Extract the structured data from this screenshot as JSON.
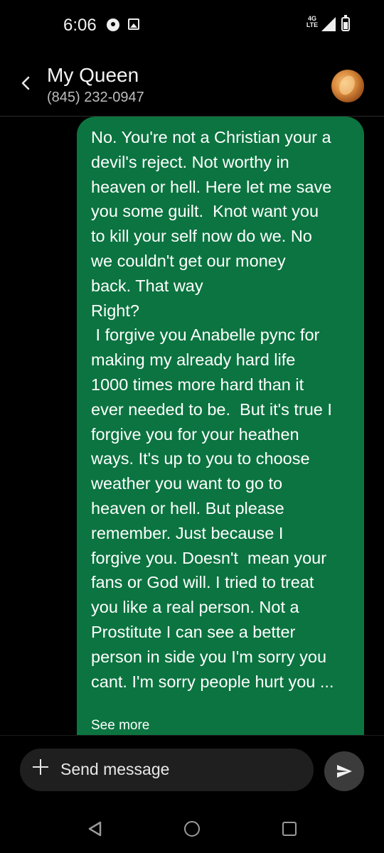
{
  "status_bar": {
    "time": "6:06",
    "network_type": "4G LTE",
    "icons": [
      "message-notification-icon",
      "gallery-icon",
      "signal-icon",
      "battery-icon"
    ]
  },
  "header": {
    "contact_name": "My Queen",
    "contact_number": "(845) 232-0947",
    "back_icon": "chevron-left-icon",
    "avatar": "contact-avatar"
  },
  "message": {
    "lines": [
      "No. You're not a Christian your a",
      "devil's reject. Not worthy in",
      "heaven or hell. Here let me save",
      "you some guilt.  Knot want you",
      "to kill your self now do we. No",
      "we couldn't get our money",
      "back. That way",
      "Right?",
      " I forgive you Anabelle pync for",
      "making my already hard life",
      "1000 times more hard than it",
      "ever needed to be.  But it's true I",
      "forgive you for your heathen",
      "ways. It's up to you to choose",
      "weather you want to go to",
      "heaven or hell. But please",
      "remember. Just because I",
      "forgive you. Doesn't  mean your",
      "fans or God will. I tried to treat",
      "you like a real person. Not a",
      "Prostitute I can see a better",
      "person in side you I'm sorry you",
      "cant. I'm sorry people hurt you ..."
    ],
    "see_more_label": "See more",
    "bubble_color": "#0b7440"
  },
  "composer": {
    "placeholder": "Send message",
    "add_icon": "plus-icon",
    "send_icon": "send-icon"
  },
  "navbar": {
    "icons": [
      "nav-back-icon",
      "nav-home-icon",
      "nav-recents-icon"
    ]
  }
}
